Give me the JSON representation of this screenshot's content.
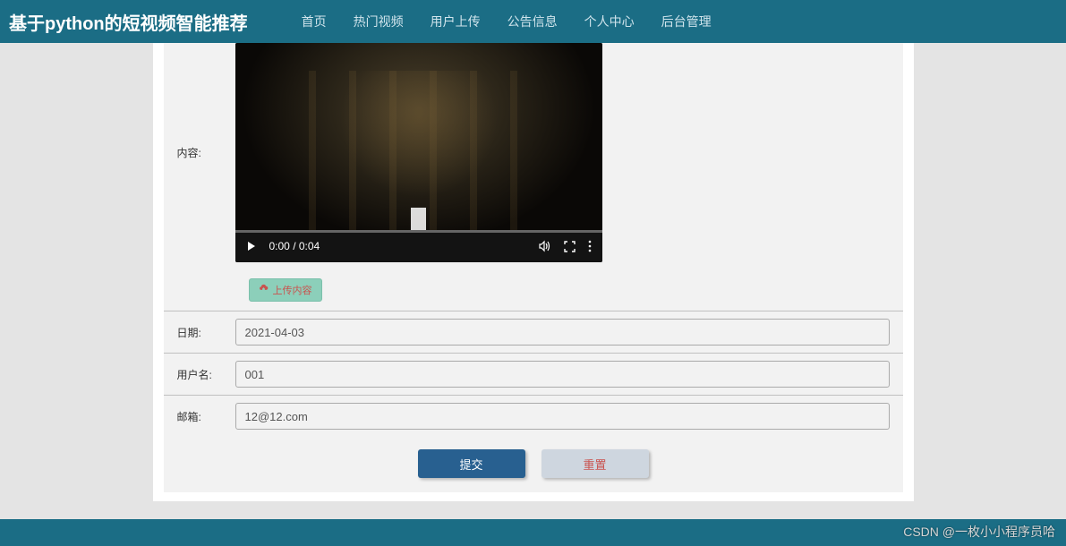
{
  "header": {
    "brand": "基于python的短视频智能推荐",
    "nav": [
      {
        "label": "首页"
      },
      {
        "label": "热门视频"
      },
      {
        "label": "用户上传"
      },
      {
        "label": "公告信息"
      },
      {
        "label": "个人中心"
      },
      {
        "label": "后台管理"
      }
    ]
  },
  "form": {
    "content_label": "内容:",
    "video": {
      "time_display": "0:00 / 0:04",
      "play_icon": "play-icon",
      "volume_icon": "volume-icon",
      "fullscreen_icon": "fullscreen-icon",
      "menu_icon": "menu-icon"
    },
    "upload_button": "上传内容",
    "fields": [
      {
        "label": "日期:",
        "value": "2021-04-03",
        "name": "date-field"
      },
      {
        "label": "用户名:",
        "value": "001",
        "name": "username-field"
      },
      {
        "label": "邮箱:",
        "value": "12@12.com",
        "name": "email-field"
      }
    ],
    "buttons": {
      "submit": "提交",
      "reset": "重置"
    }
  },
  "watermark": "CSDN @一枚小小程序员哈"
}
